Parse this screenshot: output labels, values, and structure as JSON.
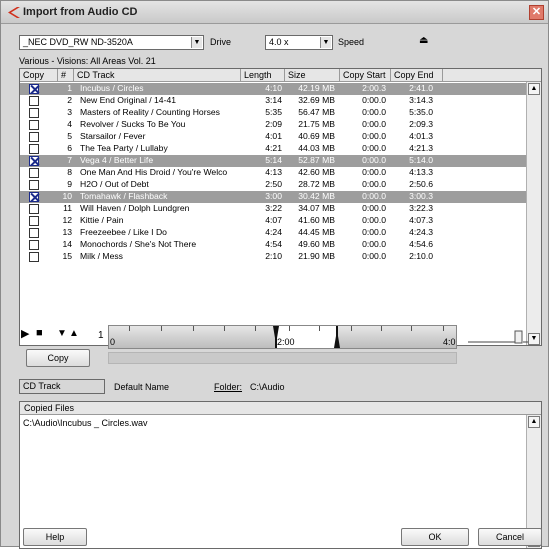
{
  "window": {
    "title": "Import from Audio CD",
    "close_glyph": "✕"
  },
  "drive": {
    "value": "_NEC  DVD_RW ND-3520A",
    "label": "Drive"
  },
  "speed": {
    "value": "4.0 x",
    "label": "Speed"
  },
  "album_title": "Various - Visions: All Areas Vol. 21",
  "columns": [
    "Copy",
    "#",
    "CD Track",
    "Length",
    "Size",
    "Copy Start",
    "Copy End"
  ],
  "tracks": [
    {
      "num": "1",
      "title": "Incubus / Circles",
      "length": "4:10",
      "size": "42.19 MB",
      "start": "2:00.3",
      "end": "2:41.0",
      "checked": true,
      "selected": true
    },
    {
      "num": "2",
      "title": "New End Original / 14-41",
      "length": "3:14",
      "size": "32.69 MB",
      "start": "0:00.0",
      "end": "3:14.3",
      "checked": false,
      "selected": false
    },
    {
      "num": "3",
      "title": "Masters of Reality / Counting Horses",
      "length": "5:35",
      "size": "56.47 MB",
      "start": "0:00.0",
      "end": "5:35.0",
      "checked": false,
      "selected": false
    },
    {
      "num": "4",
      "title": "Revolver / Sucks To Be You",
      "length": "2:09",
      "size": "21.75 MB",
      "start": "0:00.0",
      "end": "2:09.3",
      "checked": false,
      "selected": false
    },
    {
      "num": "5",
      "title": "Starsailor / Fever",
      "length": "4:01",
      "size": "40.69 MB",
      "start": "0:00.0",
      "end": "4:01.3",
      "checked": false,
      "selected": false
    },
    {
      "num": "6",
      "title": "The Tea Party / Lullaby",
      "length": "4:21",
      "size": "44.03 MB",
      "start": "0:00.0",
      "end": "4:21.3",
      "checked": false,
      "selected": false
    },
    {
      "num": "7",
      "title": "Vega 4 / Better Life",
      "length": "5:14",
      "size": "52.87 MB",
      "start": "0:00.0",
      "end": "5:14.0",
      "checked": true,
      "selected": true
    },
    {
      "num": "8",
      "title": "One Man And His Droid / You're Welco",
      "length": "4:13",
      "size": "42.60 MB",
      "start": "0:00.0",
      "end": "4:13.3",
      "checked": false,
      "selected": false
    },
    {
      "num": "9",
      "title": "H2O / Out of Debt",
      "length": "2:50",
      "size": "28.72 MB",
      "start": "0:00.0",
      "end": "2:50.6",
      "checked": false,
      "selected": false
    },
    {
      "num": "10",
      "title": "Tomahawk / Flashback",
      "length": "3:00",
      "size": "30.42 MB",
      "start": "0:00.0",
      "end": "3:00.3",
      "checked": true,
      "selected": true
    },
    {
      "num": "11",
      "title": "Will Haven / Dolph Lundgren",
      "length": "3:22",
      "size": "34.07 MB",
      "start": "0:00.0",
      "end": "3:22.3",
      "checked": false,
      "selected": false
    },
    {
      "num": "12",
      "title": "Kittie / Pain",
      "length": "4:07",
      "size": "41.60 MB",
      "start": "0:00.0",
      "end": "4:07.3",
      "checked": false,
      "selected": false
    },
    {
      "num": "13",
      "title": "Freezeebee / Like I Do",
      "length": "4:24",
      "size": "44.45 MB",
      "start": "0:00.0",
      "end": "4:24.3",
      "checked": false,
      "selected": false
    },
    {
      "num": "14",
      "title": "Monochords / She's Not There",
      "length": "4:54",
      "size": "49.60 MB",
      "start": "0:00.0",
      "end": "4:54.6",
      "checked": false,
      "selected": false
    },
    {
      "num": "15",
      "title": "Milk / Mess",
      "length": "2:10",
      "size": "21.90 MB",
      "start": "0:00.0",
      "end": "2:10.0",
      "checked": false,
      "selected": false
    }
  ],
  "transport": {
    "play": "▶",
    "stop": "■",
    "prev": "▼",
    "next": "▲"
  },
  "ruler": {
    "start": "1",
    "start_sub": "0",
    "mid": "2:00",
    "end": "4:0"
  },
  "copy_button": "Copy",
  "naming": {
    "field": "CD Track",
    "default_label": "Default Name",
    "folder_label": "Folder:",
    "folder_path": "C:\\Audio"
  },
  "copied_files": {
    "header": "Copied Files",
    "items": [
      "C:\\Audio\\Incubus _ Circles.wav"
    ]
  },
  "buttons": {
    "help": "Help",
    "ok": "OK",
    "cancel": "Cancel"
  },
  "colors": {
    "selected_row": "#9d9d9d",
    "checkbox": "#1a2a8a",
    "accent_red": "#d0301c"
  }
}
